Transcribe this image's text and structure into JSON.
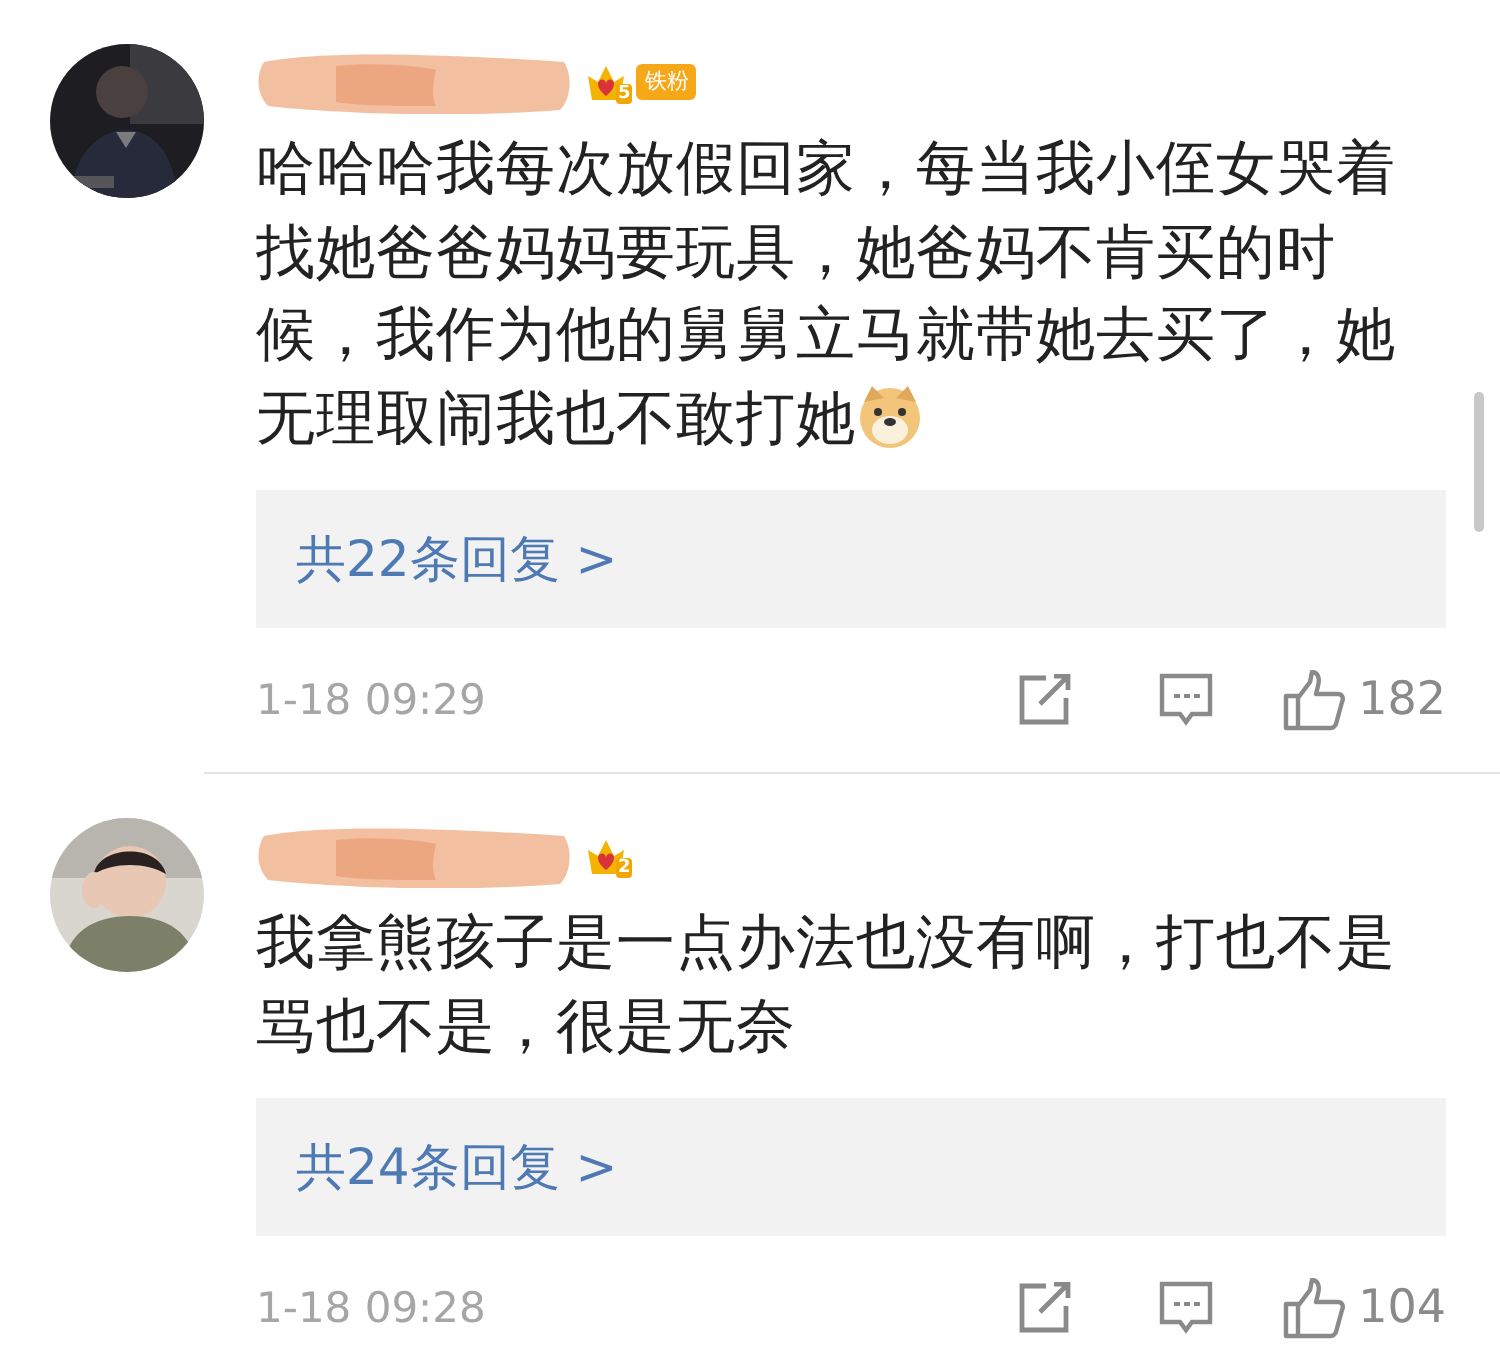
{
  "comments": [
    {
      "badge": {
        "kind": "fan",
        "level": "5",
        "label": "铁粉"
      },
      "text": "哈哈哈我每次放假回家，每当我小侄女哭着找她爸爸妈妈要玩具，她爸妈不肯买的时候，我作为他的舅舅立马就带她去买了，她无理取闹我也不敢打她",
      "sticker": true,
      "replies": "共22条回复 >",
      "time": "1-18 09:29",
      "likes": "182"
    },
    {
      "badge": {
        "kind": "crown",
        "level": "2"
      },
      "text": "我拿熊孩子是一点办法也没有啊，打也不是骂也不是，很是无奈",
      "replies": "共24条回复 >",
      "time": "1-18 09:28",
      "likes": "104"
    }
  ]
}
